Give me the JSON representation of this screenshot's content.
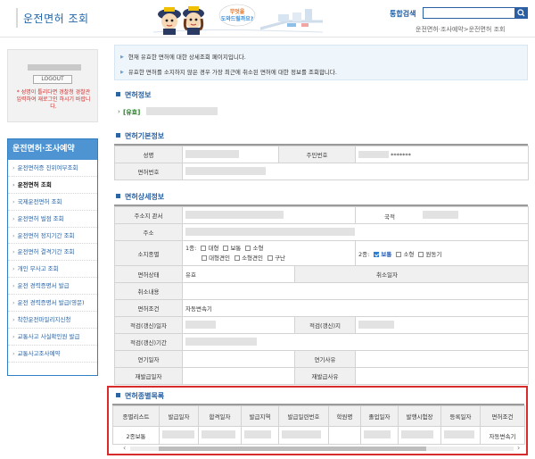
{
  "header": {
    "title": "운전면허 조회",
    "search_label": "통합검색",
    "search_placeholder": "",
    "breadcrumb": "운전면허·조사예약>운전면허 조회"
  },
  "login": {
    "logout_label": "LOGOUT",
    "note": "* 성명이 틀리다면 경찰청 경찰관 입력하여 재로그인 하시기 바랍니다."
  },
  "nav": {
    "heading": "운전면허·조사예약",
    "items": [
      "운전면허증 진위여부조회",
      "운전면허 조회",
      "국제운전면허 조회",
      "운전면허 벌점 조회",
      "운전면허 정지기간 조회",
      "운전면허 결격기간 조회",
      "개인 무사고 조회",
      "운전 경력증명서 발급",
      "운전 경력증명서 발급(영문)",
      "착한운전마일리지신청",
      "교통사고 사실확인원 발급",
      "교통사고조사예약"
    ]
  },
  "notice": {
    "line1": "현재 유효한 면허에 대한 상세조회 페이지입니다.",
    "line2": "유효한 면허를 소지하지 않은 경우 가장 최근에 취소된 면허에 대한 정보를 조회합니다."
  },
  "sections": {
    "license_info": "면허정보",
    "license_type": "[유효]",
    "basic_info": "면허기본정보",
    "detail_info": "면허상세정보",
    "class_list": "면허종별목록"
  },
  "basic": {
    "name_label": "성명",
    "rrn_label": "주민번호",
    "rrn_value": "*******",
    "license_no_label": "면허번호"
  },
  "detail": {
    "address_office_label": "주소지 관서",
    "nationality_label": "국적",
    "address_label": "주소",
    "classes_label": "소지종별",
    "class1_prefix": "1종:",
    "class1_opts": [
      "대형",
      "보통",
      "소형",
      "대형견인",
      "소형견인",
      "구난"
    ],
    "class2_prefix": "2종:",
    "class2_opts": [
      "보통",
      "소형",
      "원동기"
    ],
    "status_label": "면허상태",
    "status_value": "유효",
    "cancel_date_label": "취소일자",
    "cancel_content_label": "취소내용",
    "condition_label": "면허조건",
    "condition_value": "자동변속기",
    "fit_date_label": "적검(갱신)일자",
    "fit_area_label": "적검(갱신)지",
    "fit_period_label": "적검(갱신)기간",
    "extend_date_label": "연기일자",
    "extend_reason_label": "연기사유",
    "reissue_date_label": "재발급일자",
    "reissue_reason_label": "재발급사유"
  },
  "class_table": {
    "columns": [
      "종별리스트",
      "발급일자",
      "합격일자",
      "발급지역",
      "발급일련번호",
      "학원명",
      "졸업일자",
      "발행시험장",
      "등록일자",
      "면허조건"
    ],
    "row": {
      "class": "2종보통",
      "condition": "자동변속기"
    }
  }
}
